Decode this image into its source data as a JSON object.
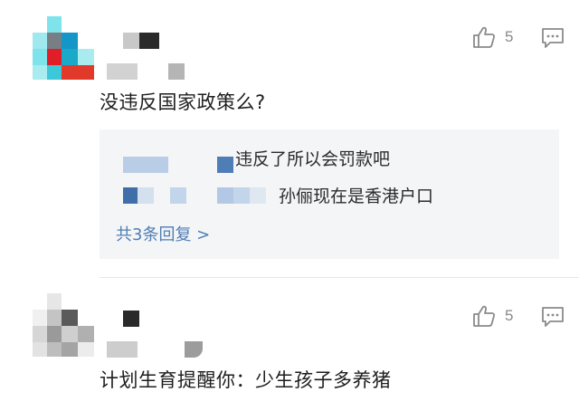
{
  "comments": [
    {
      "text": "没违反国家政策么?",
      "likes": "5",
      "icons": {
        "like": "thumbs-up-icon",
        "comment": "comment-bubble-icon"
      },
      "replies": [
        {
          "text": "违反了所以会罚款吧"
        },
        {
          "text": "孙俪现在是香港户口"
        }
      ],
      "more_replies": "共3条回复 >"
    },
    {
      "text": "计划生育提醒你：少生孩子多养猪",
      "likes": "5",
      "icons": {
        "like": "thumbs-up-icon",
        "comment": "comment-bubble-icon"
      }
    }
  ],
  "colors": {
    "link": "#4f7db5",
    "reply_bg": "#f4f5f6",
    "icon": "#8a8a8a",
    "avatar_cyan": "#3cc8d8",
    "avatar_red": "#e23a2a"
  }
}
